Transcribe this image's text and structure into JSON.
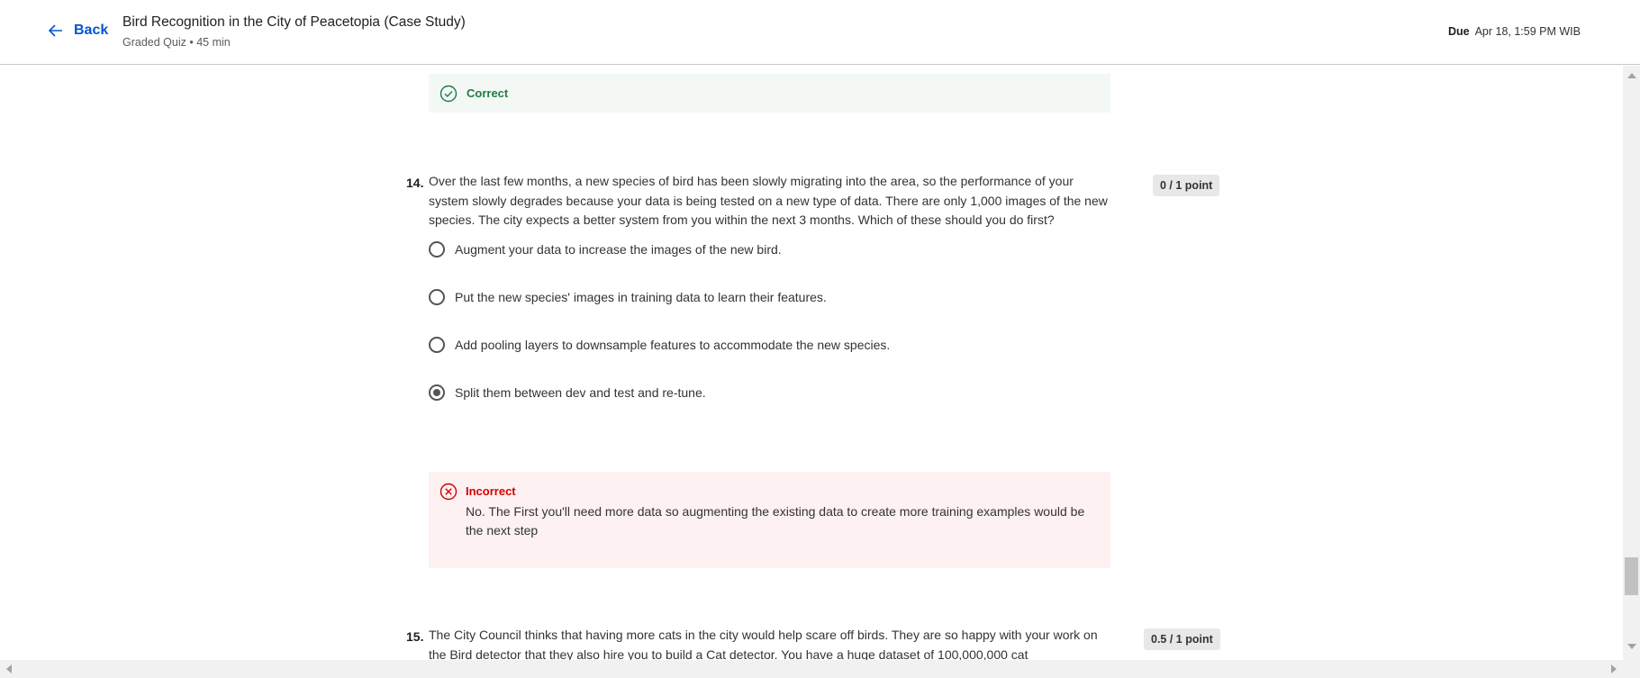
{
  "header": {
    "back_label": "Back",
    "title": "Bird Recognition in the City of Peacetopia (Case Study)",
    "subtitle": "Graded Quiz • 45 min",
    "due_label": "Due",
    "due_value": "Apr 18, 1:59 PM WIB"
  },
  "prev_feedback": {
    "label": "Correct",
    "color": "#1e7d43"
  },
  "q14": {
    "number": "14.",
    "text": "Over the last few months, a new species of bird has been slowly migrating into the area, so the performance of your system slowly degrades because your data is being tested on a new type of data. There are only 1,000 images of the new species. The city expects a better system from you within the next 3 months. Which of these should you do first?",
    "points": "0 / 1 point",
    "options": [
      {
        "label": "Augment your data to increase the images of the new bird.",
        "selected": false
      },
      {
        "label": "Put the new species' images in training data to learn their features.",
        "selected": false
      },
      {
        "label": "Add pooling layers to downsample features to accommodate the new species.",
        "selected": false
      },
      {
        "label": "Split them between dev and test and re-tune.",
        "selected": true
      }
    ],
    "feedback": {
      "label": "Incorrect",
      "text": "No. The First you'll need more data so augmenting the existing data to create more training examples would be the next step",
      "color": "#d30001"
    }
  },
  "q15": {
    "number": "15.",
    "text": "The City Council thinks that having more cats in the city would help scare off birds. They are so happy with your work on the Bird detector that they also hire you to build a Cat detector. You have a huge dataset of 100,000,000 cat",
    "points": "0.5 / 1 point"
  },
  "colors": {
    "accent": "#0056d2",
    "correct_bg": "#f3f8f5",
    "incorrect_bg": "#fdf1f1"
  }
}
